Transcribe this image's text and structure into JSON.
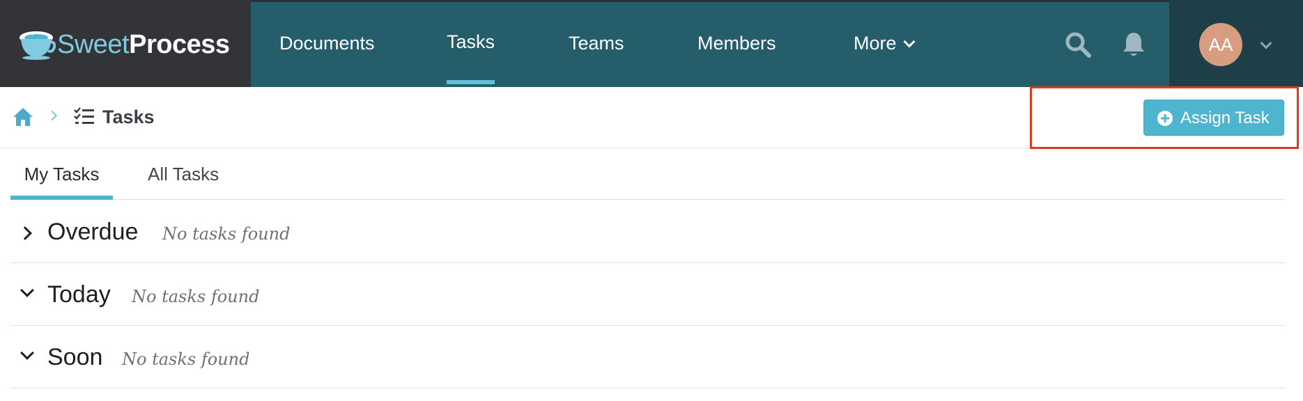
{
  "app": {
    "logo_sweet": "Sweet",
    "logo_process": "Process"
  },
  "nav": {
    "items": [
      {
        "label": "Documents"
      },
      {
        "label": "Tasks"
      },
      {
        "label": "Teams"
      },
      {
        "label": "Members"
      },
      {
        "label": "More"
      }
    ],
    "active": "Tasks",
    "icons": [
      "search-icon",
      "bell-icon",
      "chevron-down-icon"
    ]
  },
  "user": {
    "initials": "AA",
    "avatar_color": "#d89c80"
  },
  "breadcrumb": {
    "icons": [
      "home-icon",
      "chevron-right-icon",
      "checklist-icon"
    ],
    "title": "Tasks"
  },
  "actions": {
    "assign_task": "Assign Task",
    "assign_icon": "plus-circle-icon",
    "button_color": "#4fb5cf"
  },
  "tabs": {
    "items": [
      {
        "label": "My Tasks"
      },
      {
        "label": "All Tasks"
      }
    ],
    "active": "My Tasks"
  },
  "sections": [
    {
      "title": "Overdue",
      "empty": "No tasks found",
      "expanded": false
    },
    {
      "title": "Today",
      "empty": "No tasks found",
      "expanded": true
    },
    {
      "title": "Soon",
      "empty": "No tasks found",
      "expanded": true
    }
  ],
  "colors": {
    "nav_bg": "#265d6b",
    "logo_bg": "#323438",
    "user_bg": "#1f3f48",
    "accent": "#5fc1dc",
    "highlight_border": "#e03a1e"
  }
}
